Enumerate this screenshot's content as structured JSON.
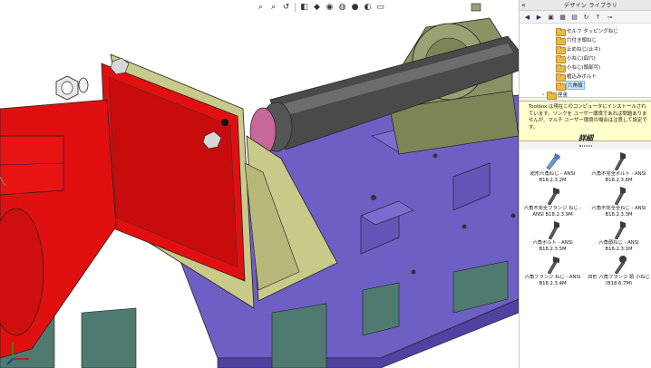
{
  "task_pane": {
    "title": "デザイン ライブラリ",
    "collapse_glyph": "«",
    "toolbar_icons": [
      "back-icon",
      "forward-icon",
      "add-folder-icon",
      "library-icon",
      "new-folder-icon",
      "refresh-icon",
      "up-icon",
      "pin-icon"
    ],
    "tree": [
      {
        "label": "セルフ タッピングねじ",
        "selected": false
      },
      {
        "label": "穴付き頭ねじ",
        "selected": false
      },
      {
        "label": "止めねじ(止ネ)",
        "selected": false
      },
      {
        "label": "小ねじ(皿穴)",
        "selected": false
      },
      {
        "label": "小ねじ(頭部可)",
        "selected": false
      },
      {
        "label": "植込みボルト",
        "selected": false
      },
      {
        "label": "六角頭",
        "selected": true
      },
      {
        "label": "座金",
        "selected": false
      }
    ],
    "info": {
      "text": "Toolbox は現在このコンピュータにインストールされています。リンクを ユーザー環境であれば問題ありませんが、マルチ ユーザー環境の場合は注意して設定です。",
      "details": "詳細"
    },
    "parts": [
      {
        "line1": "総形六角ねじ - ANSI",
        "line2": "B18.2.3.2M",
        "color": "#4a7fb5"
      },
      {
        "line1": "六角不完全ボルト - ANSI",
        "line2": "B18.2.3.6M",
        "color": "#3a3a3a"
      },
      {
        "line1": "六角不完全フランジ ねじ -",
        "line2": "ANSI B18.2.3.9M",
        "color": "#3a3a3a"
      },
      {
        "line1": "六角不完全全ねじ - ANSI",
        "line2": "B18.2.3.3M",
        "color": "#3a3a3a"
      },
      {
        "line1": "六角ボルト - ANSI",
        "line2": "B18.2.3.5M",
        "color": "#3a3a3a"
      },
      {
        "line1": "六角頭ねじ - ANSI",
        "line2": "B18.2.3.1M",
        "color": "#3a3a3a"
      },
      {
        "line1": "六角フランジ ねじ - ANSI",
        "line2": "B18.2.3.4M",
        "color": "#3a3a3a"
      },
      {
        "line1": "凹形 六角フランジ 頭 小ねじ",
        "line2": "(B18.6.7M)",
        "color": "#3a3a3a"
      }
    ]
  },
  "viewport": {
    "heads_up_icons": [
      "zoom-fit-icon",
      "zoom-area-icon",
      "previous-view-icon",
      "section-view-icon",
      "view-orientation-icon",
      "display-style-icon",
      "hide-show-icon",
      "edit-appearance-icon",
      "scene-icon",
      "view-settings-icon"
    ],
    "colors": {
      "motor": "#e01010",
      "bracket": "#c9c98a",
      "base": "#6e5fc4",
      "shaft": "#4a4a4a",
      "bearing": "#8a9163",
      "coupling": "#c7679a",
      "feet": "#4f7a6f"
    }
  }
}
